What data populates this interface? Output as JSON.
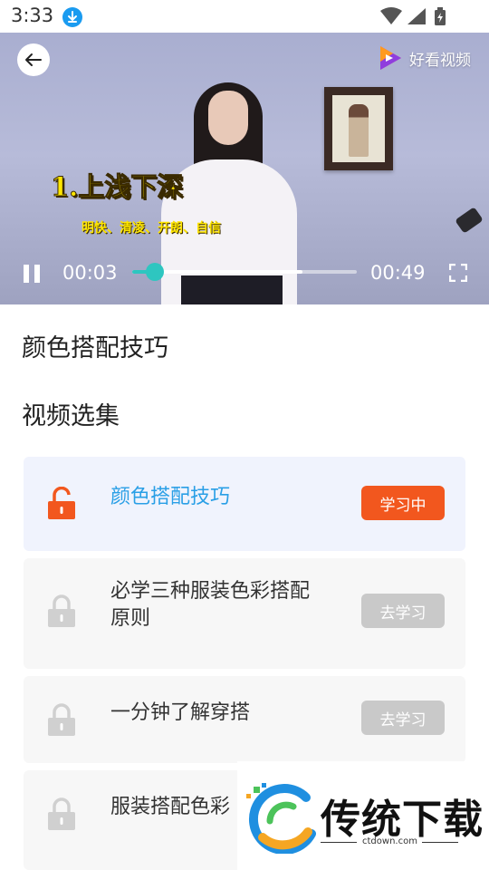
{
  "status_bar": {
    "time": "3:33",
    "icons": [
      "download-icon",
      "wifi-icon",
      "signal-icon",
      "battery-charging-icon"
    ]
  },
  "video": {
    "brand_name": "好看视频",
    "overlay_title": "1.上浅下深",
    "overlay_subtitle": "明快、清凌、开朗、自信",
    "current_time": "00:03",
    "total_time": "00:49",
    "played_fraction": 0.1,
    "buffered_fraction": 0.76,
    "playing": true
  },
  "page": {
    "title": "颜色搭配技巧",
    "section_title": "视频选集"
  },
  "episodes": [
    {
      "title": "颜色搭配技巧",
      "button": "学习中",
      "state": "active",
      "lock_icon": "unlock-icon"
    },
    {
      "title": "必学三种服装色彩搭配原则",
      "button": "去学习",
      "state": "locked",
      "lock_icon": "lock-icon"
    },
    {
      "title": "一分钟了解穿搭",
      "button": "去学习",
      "state": "locked",
      "lock_icon": "lock-icon"
    },
    {
      "title": "服装搭配色彩",
      "button": "",
      "state": "locked",
      "lock_icon": "lock-icon"
    }
  ],
  "watermark": {
    "text": "传统下载",
    "url": "ctdown.com"
  },
  "colors": {
    "accent_blue": "#2a9fe6",
    "active_button": "#f2571e",
    "inactive_button": "#c9c9c9",
    "progress": "#2ec6c0"
  }
}
